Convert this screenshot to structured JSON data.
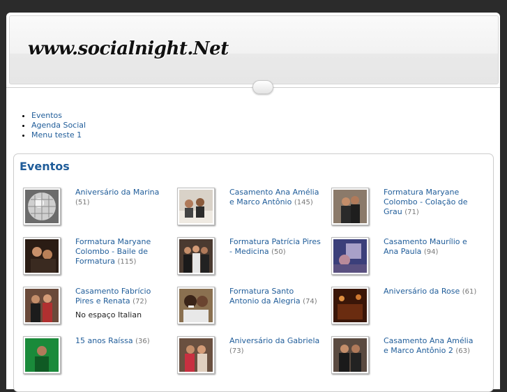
{
  "header": {
    "site_logo": "www.socialnight.Net"
  },
  "menu": {
    "items": [
      {
        "label": "Eventos"
      },
      {
        "label": "Agenda Social"
      },
      {
        "label": "Menu teste 1"
      }
    ]
  },
  "events": {
    "title": "Eventos",
    "items": [
      {
        "title": "Aniversário da Marina",
        "count": "(51)",
        "desc": ""
      },
      {
        "title": "Casamento Ana Amélia e Marco Antônio",
        "count": "(145)",
        "desc": ""
      },
      {
        "title": "Formatura Maryane Colombo - Colação de Grau",
        "count": "(71)",
        "desc": ""
      },
      {
        "title": "Formatura Maryane Colombo - Baile de Formatura",
        "count": "(115)",
        "desc": ""
      },
      {
        "title": "Formatura Patrícia Pires - Medicina",
        "count": "(50)",
        "desc": ""
      },
      {
        "title": "Casamento Maurílio e Ana Paula",
        "count": "(94)",
        "desc": ""
      },
      {
        "title": "Casamento Fabrício Pires e Renata",
        "count": "(72)",
        "desc": "No espaço Italian"
      },
      {
        "title": "Formatura Santo Antonio da Alegria",
        "count": "(74)",
        "desc": ""
      },
      {
        "title": "Aniversário da Rose",
        "count": "(61)",
        "desc": ""
      },
      {
        "title": "15 anos Raíssa",
        "count": "(36)",
        "desc": ""
      },
      {
        "title": "Aniversário da Gabriela",
        "count": "(73)",
        "desc": ""
      },
      {
        "title": "Casamento Ana Amélia e Marco Antônio 2",
        "count": "(63)",
        "desc": ""
      }
    ]
  },
  "colors": {
    "link": "#1f5c99",
    "count": "#777777",
    "page_bg": "#2b2b2b"
  }
}
